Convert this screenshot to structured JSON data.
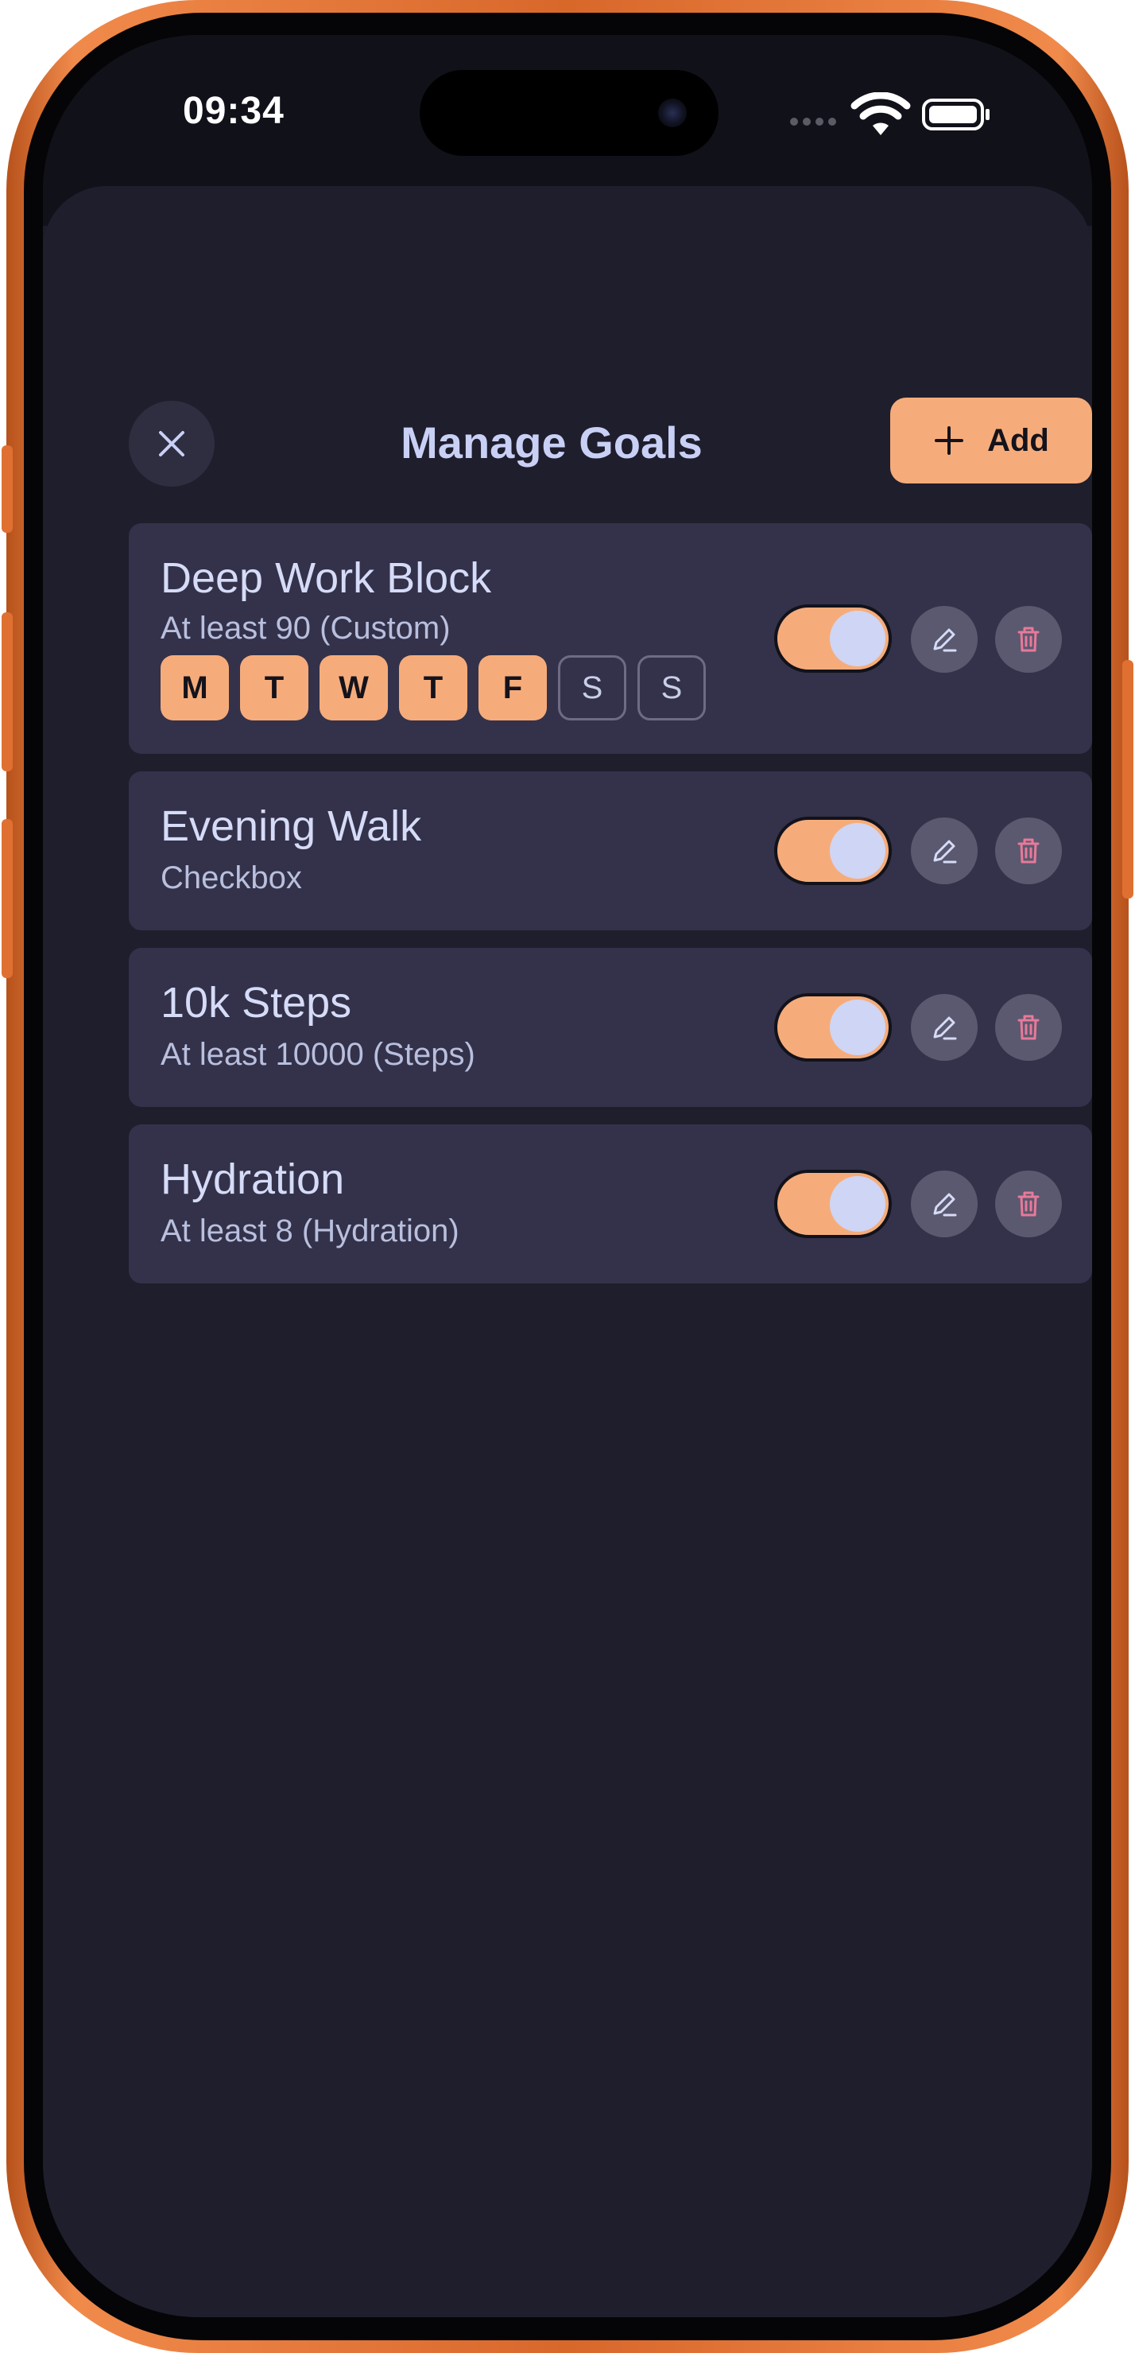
{
  "status_bar": {
    "time": "09:34"
  },
  "header": {
    "title": "Manage Goals",
    "add_label": "Add"
  },
  "goals": [
    {
      "title": "Deep Work Block",
      "subtitle": "At least 90 (Custom)",
      "enabled": true,
      "days": [
        {
          "label": "M",
          "active": true
        },
        {
          "label": "T",
          "active": true
        },
        {
          "label": "W",
          "active": true
        },
        {
          "label": "T",
          "active": true
        },
        {
          "label": "F",
          "active": true
        },
        {
          "label": "S",
          "active": false
        },
        {
          "label": "S",
          "active": false
        }
      ]
    },
    {
      "title": "Evening Walk",
      "subtitle": "Checkbox",
      "enabled": true
    },
    {
      "title": "10k Steps",
      "subtitle": "At least 10000 (Steps)",
      "enabled": true
    },
    {
      "title": "Hydration",
      "subtitle": "At least 8 (Hydration)",
      "enabled": true
    }
  ],
  "colors": {
    "accent": "#f6ac7a",
    "background": "#1f1e2d",
    "card": "#33324a",
    "title_text": "#c9d0f5",
    "delete_icon": "#e8799a",
    "frame": "#e47a3c"
  },
  "icons": {
    "close": "close-icon",
    "add": "plus-icon",
    "edit": "pencil-icon",
    "delete": "trash-icon",
    "wifi": "wifi-icon",
    "battery": "battery-icon"
  }
}
